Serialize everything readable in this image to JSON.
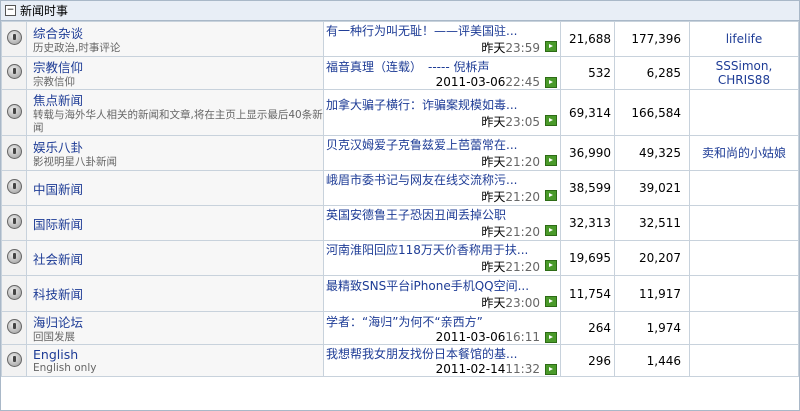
{
  "category": {
    "toggle": "−",
    "title": "新闻时事"
  },
  "forums": [
    {
      "name": "综合杂谈",
      "desc": "历史政治,时事评论",
      "last_title": "有一种行为叫无耻！——评美国驻...",
      "last_date": "昨天",
      "last_time": "23:59",
      "topics": "21,688",
      "posts": "177,396",
      "mods": [
        "lifelife"
      ]
    },
    {
      "name": "宗教信仰",
      "desc": "宗教信仰",
      "last_title": "福音真理（连载）　----- 倪柝声",
      "last_date": "2011-03-06",
      "last_time": "22:45",
      "topics": "532",
      "posts": "6,285",
      "mods": [
        "SSSimon,",
        "CHRIS88"
      ]
    },
    {
      "name": "焦点新闻",
      "desc": "转载与海外华人相关的新闻和文章,将在主页上显示最后40条新闻",
      "last_title": "加拿大骗子横行：诈骗案规模如毒...",
      "last_date": "昨天",
      "last_time": "23:05",
      "topics": "69,314",
      "posts": "166,584",
      "mods": []
    },
    {
      "name": "娱乐八卦",
      "desc": "影视明星八卦新闻",
      "last_title": "贝克汉姆爱子克鲁兹爱上芭蕾常在...",
      "last_date": "昨天",
      "last_time": "21:20",
      "topics": "36,990",
      "posts": "49,325",
      "mods": [
        "卖和尚的小姑娘"
      ]
    },
    {
      "name": "中国新闻",
      "desc": "",
      "last_title": "峨眉市委书记与网友在线交流称污...",
      "last_date": "昨天",
      "last_time": "21:20",
      "topics": "38,599",
      "posts": "39,021",
      "mods": []
    },
    {
      "name": "国际新闻",
      "desc": "",
      "last_title": "英国安德鲁王子恐因丑闻丢掉公职",
      "last_date": "昨天",
      "last_time": "21:20",
      "topics": "32,313",
      "posts": "32,511",
      "mods": []
    },
    {
      "name": "社会新闻",
      "desc": "",
      "last_title": "河南淮阳回应118万天价香称用于扶...",
      "last_date": "昨天",
      "last_time": "21:20",
      "topics": "19,695",
      "posts": "20,207",
      "mods": []
    },
    {
      "name": "科技新闻",
      "desc": "",
      "last_title": "最精致SNS平台iPhone手机QQ空间...",
      "last_date": "昨天",
      "last_time": "23:00",
      "topics": "11,754",
      "posts": "11,917",
      "mods": []
    },
    {
      "name": "海归论坛",
      "desc": "回国发展",
      "last_title": "学者：“海归”为何不“亲西方”",
      "last_date": "2011-03-06",
      "last_time": "16:11",
      "topics": "264",
      "posts": "1,974",
      "mods": []
    },
    {
      "name": "English",
      "desc": "English only",
      "last_title": "我想帮我女朋友找份日本餐馆的基...",
      "last_date": "2011-02-14",
      "last_time": "11:32",
      "topics": "296",
      "posts": "1,446",
      "mods": []
    }
  ]
}
